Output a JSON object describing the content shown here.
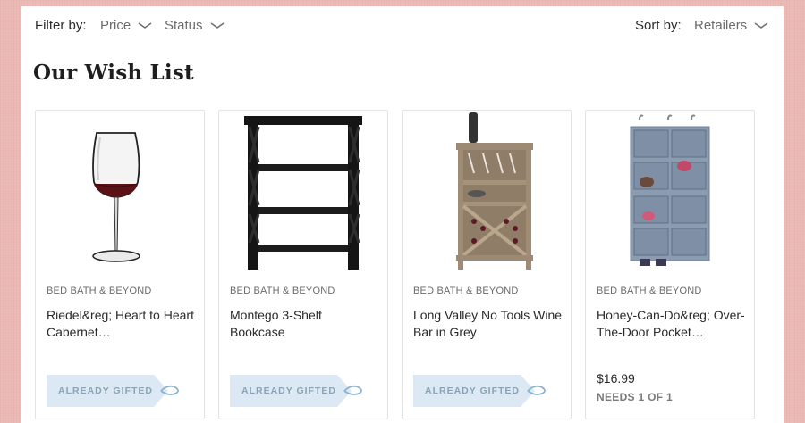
{
  "filter": {
    "label": "Filter by:",
    "price": "Price",
    "status": "Status"
  },
  "sort": {
    "label": "Sort by:",
    "value": "Retailers"
  },
  "title": "Our Wish List",
  "items": [
    {
      "retailer": "BED BATH & BEYOND",
      "name": "Riedel&reg; Heart to Heart Cabernet…",
      "status": "ALREADY GIFTED",
      "image": "wine-glass"
    },
    {
      "retailer": "BED BATH & BEYOND",
      "name": "Montego 3-Shelf Bookcase",
      "status": "ALREADY GIFTED",
      "image": "bookcase"
    },
    {
      "retailer": "BED BATH & BEYOND",
      "name": "Long Valley No Tools Wine Bar in Grey",
      "status": "ALREADY GIFTED",
      "image": "wine-bar"
    },
    {
      "retailer": "BED BATH & BEYOND",
      "name": "Honey-Can-Do&reg; Over-The-Door Pocket…",
      "price": "$16.99",
      "needs": "NEEDS 1 OF 1",
      "image": "shoe-organizer"
    }
  ],
  "colors": {
    "gifted_bg": "#dce9f4",
    "gifted_text": "#8aa3b5",
    "background": "#ebb9b4"
  }
}
